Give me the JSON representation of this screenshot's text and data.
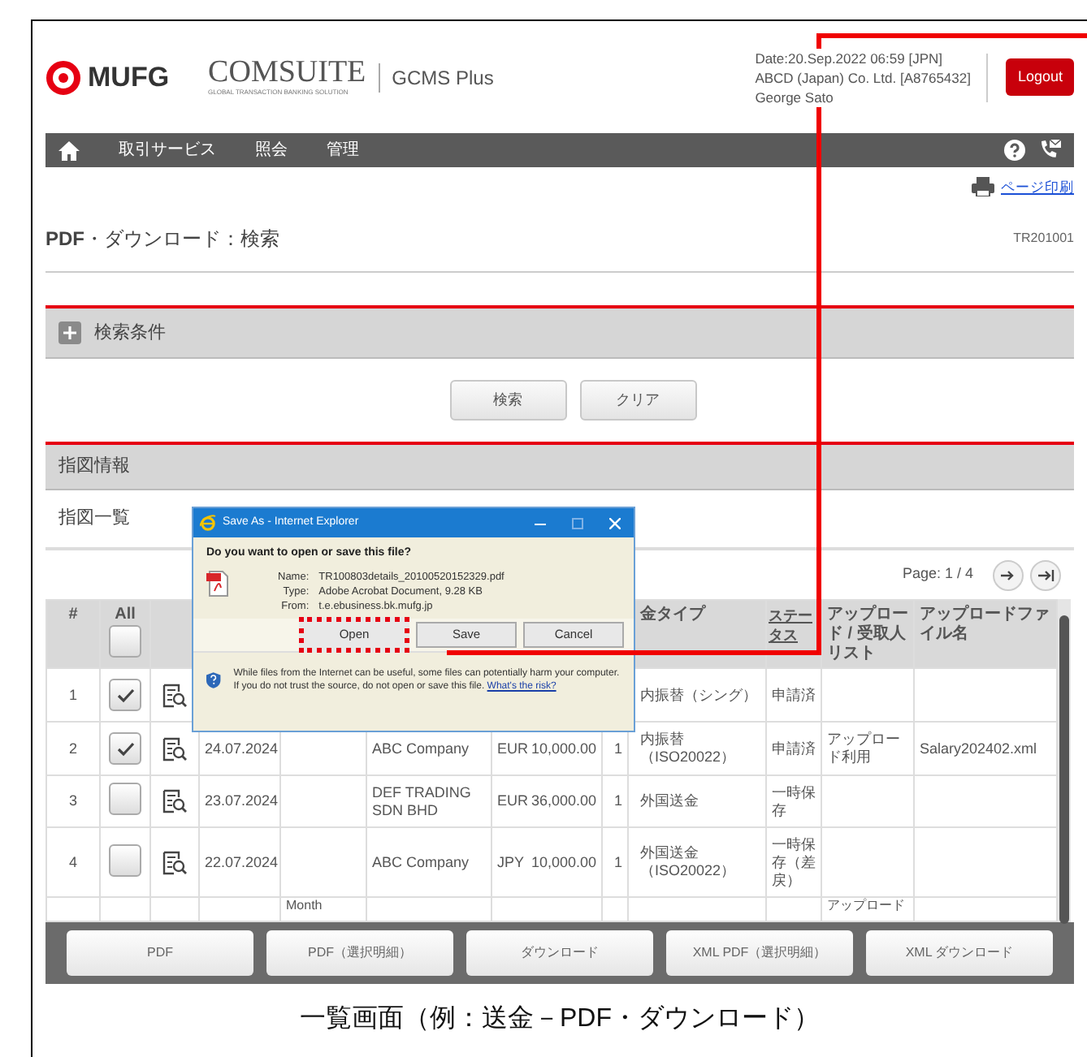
{
  "header": {
    "brand": "MUFG",
    "product": "COMSUITE",
    "product_tagline": "GLOBAL TRANSACTION BANKING SOLUTION",
    "app": "GCMS Plus",
    "date": "Date:20.Sep.2022 06:59 [JPN]",
    "company": "ABCD (Japan) Co. Ltd. [A8765432]",
    "user": "George Sato",
    "logout": "Logout"
  },
  "nav": {
    "items": [
      "取引サービス",
      "照会",
      "管理"
    ]
  },
  "print_link": "ページ印刷",
  "page_title": "**PDF**・ダウンロード：検索",
  "page_id": "TR201001",
  "search_section": {
    "title": "検索条件",
    "expanded": false
  },
  "search_buttons": [
    "検索",
    "クリア"
  ],
  "info_section": {
    "title": "指図情報"
  },
  "list_title": "指図一覧",
  "pagination": "Page: 1 / 4",
  "table": {
    "columns": [
      {
        "label": "#"
      },
      {
        "label": "All",
        "checked": false
      },
      {},
      {},
      {},
      {},
      {},
      {},
      {
        "label": "金タイプ"
      },
      {
        "label": "ステータス",
        "link": true
      },
      {
        "label": "アップロード / 受取人リスト"
      },
      {
        "label": "アップロードファイル名"
      }
    ],
    "rows": [
      {
        "no": "1",
        "checked": true,
        "type": "内振替（シング）",
        "status": "申請済"
      },
      {
        "no": "2",
        "checked": true,
        "date": "24.07.2024",
        "company": "ABC Company",
        "currency": "EUR",
        "amount": "10,000.00",
        "count": "1",
        "type": "内振替（ISO20022）",
        "status": "申請済",
        "upload": "アップロード利用",
        "file": "Salary202402.xml"
      },
      {
        "no": "3",
        "checked": false,
        "date": "23.07.2024",
        "company": "DEF TRADING SDN BHD",
        "currency": "EUR",
        "amount": "36,000.00",
        "count": "1",
        "type": "外国送金",
        "status": "一時保存"
      },
      {
        "no": "4",
        "checked": false,
        "date": "22.07.2024",
        "company": "ABC Company",
        "currency": "JPY",
        "amount": "10,000.00",
        "count": "1",
        "type": "外国送金（ISO20022）",
        "status": "一時保存（差戻）"
      },
      {
        "column_5": "Month",
        "upload": "アップロード"
      }
    ]
  },
  "action_buttons": [
    "PDF",
    "PDF（選択明細）",
    "ダウンロード",
    "XML PDF（選択明細）",
    "XML ダウンロード"
  ],
  "dialog": {
    "title": "Save As - Internet Explorer",
    "question": "Do you want to open or save this file?",
    "fields": [
      {
        "label": "Name:",
        "value": "TR100803details_20100520152329.pdf"
      },
      {
        "label": "Type:",
        "value": "Adobe Acrobat Document, 9.28 KB"
      },
      {
        "label": "From:",
        "value": "t.e.ebusiness.bk.mufg.jp"
      }
    ],
    "buttons": [
      {
        "label": "Open",
        "highlighted": true
      },
      {
        "label": "Save",
        "highlighted": false
      },
      {
        "label": "Cancel",
        "highlighted": false
      }
    ],
    "warning": "While files from the Internet can be useful, some files can potentially harm your computer. If you do not trust the source, do not open or save this file.",
    "risk_link": "What's the risk?"
  },
  "caption": "一覧画面（例：送金－PDF・ダウンロード）"
}
